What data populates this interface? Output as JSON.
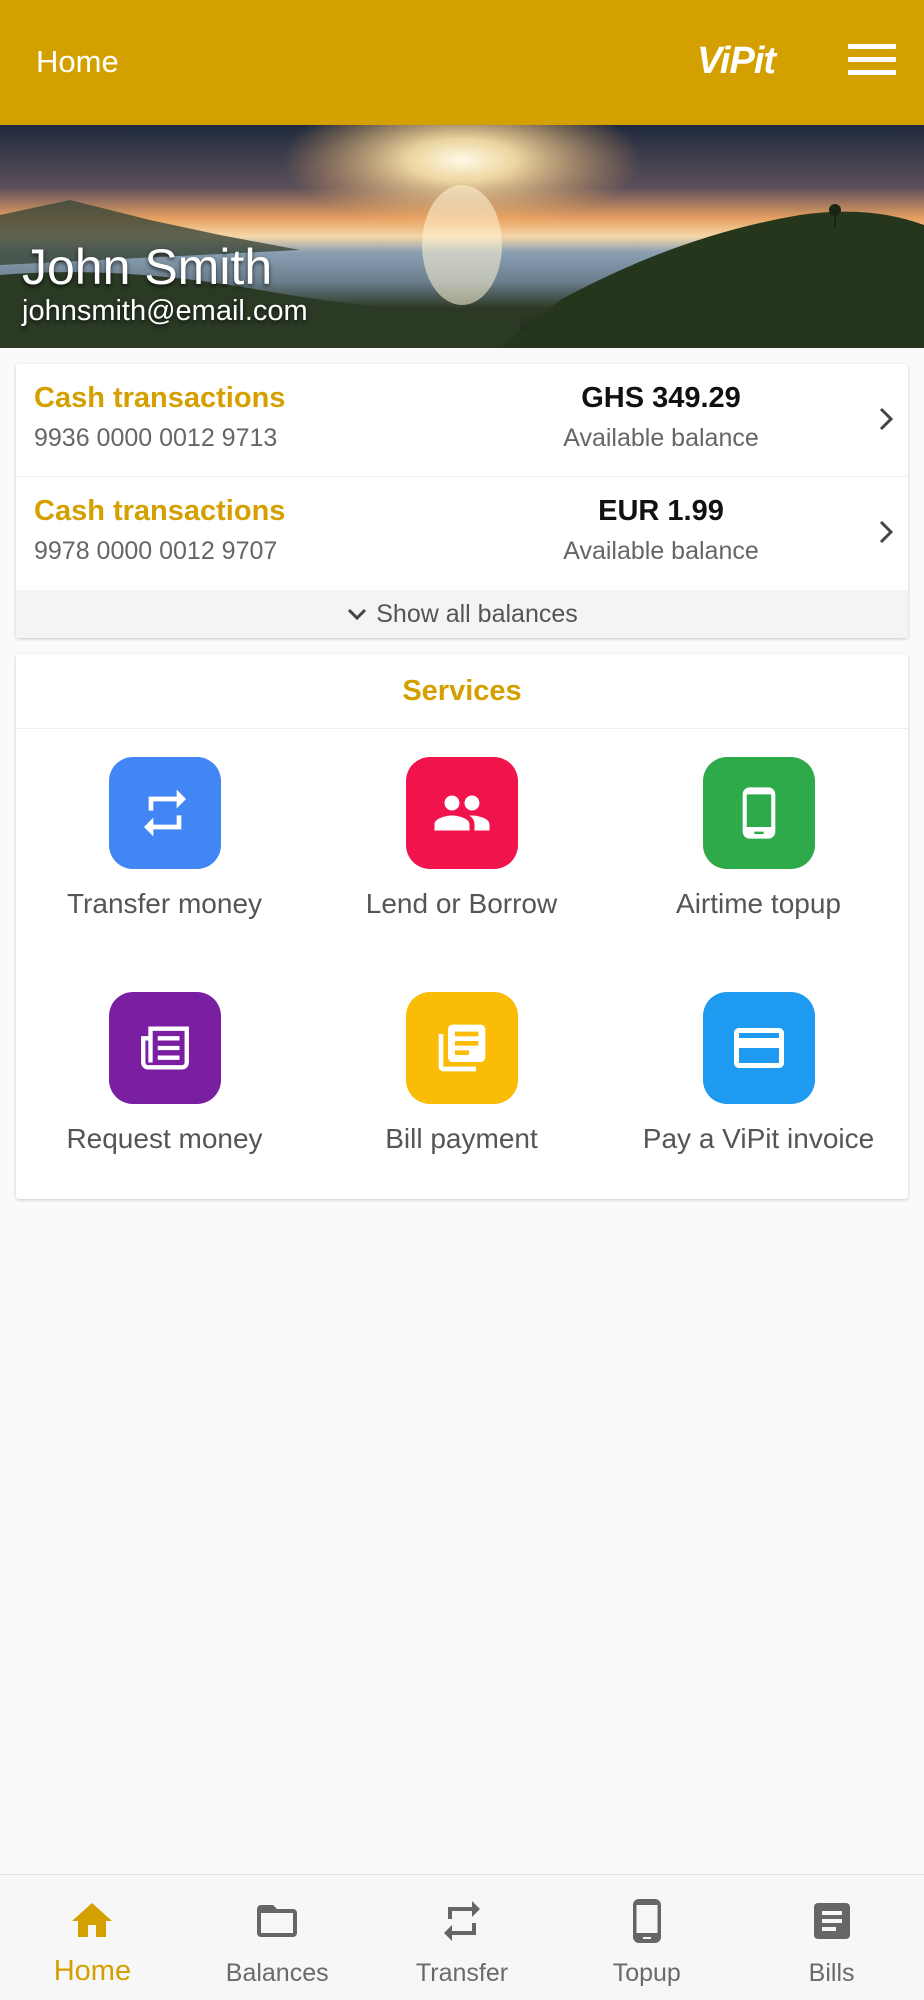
{
  "appbar": {
    "title": "Home",
    "logo_text": "ViPit",
    "menu_icon": "hamburger-menu-icon"
  },
  "hero": {
    "name": "John Smith",
    "email": "johnsmith@email.com"
  },
  "balances": {
    "rows": [
      {
        "name": "Cash transactions",
        "account": "9936 0000 0012 9713",
        "amount": "GHS 349.29",
        "caption": "Available balance"
      },
      {
        "name": "Cash transactions",
        "account": "9978 0000 0012 9707",
        "amount": "EUR 1.99",
        "caption": "Available balance"
      }
    ],
    "show_all_label": "Show all balances"
  },
  "services": {
    "title": "Services",
    "items": [
      {
        "label": "Transfer money",
        "icon": "transfer-icon",
        "color": "#4285f4"
      },
      {
        "label": "Lend or Borrow",
        "icon": "people-icon",
        "color": "#f0134c"
      },
      {
        "label": "Airtime topup",
        "icon": "phone-icon",
        "color": "#2eaa4a"
      },
      {
        "label": "Request money",
        "icon": "newspaper-icon",
        "color": "#7b1fa2"
      },
      {
        "label": "Bill payment",
        "icon": "documents-icon",
        "color": "#fbbc05"
      },
      {
        "label": "Pay a ViPit invoice",
        "icon": "credit-card-icon",
        "color": "#1e9af0"
      }
    ]
  },
  "bottom_nav": {
    "items": [
      {
        "label": "Home",
        "icon": "home-icon",
        "active": true
      },
      {
        "label": "Balances",
        "icon": "folder-icon",
        "active": false
      },
      {
        "label": "Transfer",
        "icon": "transfer-icon",
        "active": false
      },
      {
        "label": "Topup",
        "icon": "phone-icon",
        "active": false
      },
      {
        "label": "Bills",
        "icon": "bill-icon",
        "active": false
      }
    ]
  },
  "colors": {
    "brand": "#d4a000",
    "background": "#fafafa",
    "nav_inactive": "#6a6a6a"
  }
}
